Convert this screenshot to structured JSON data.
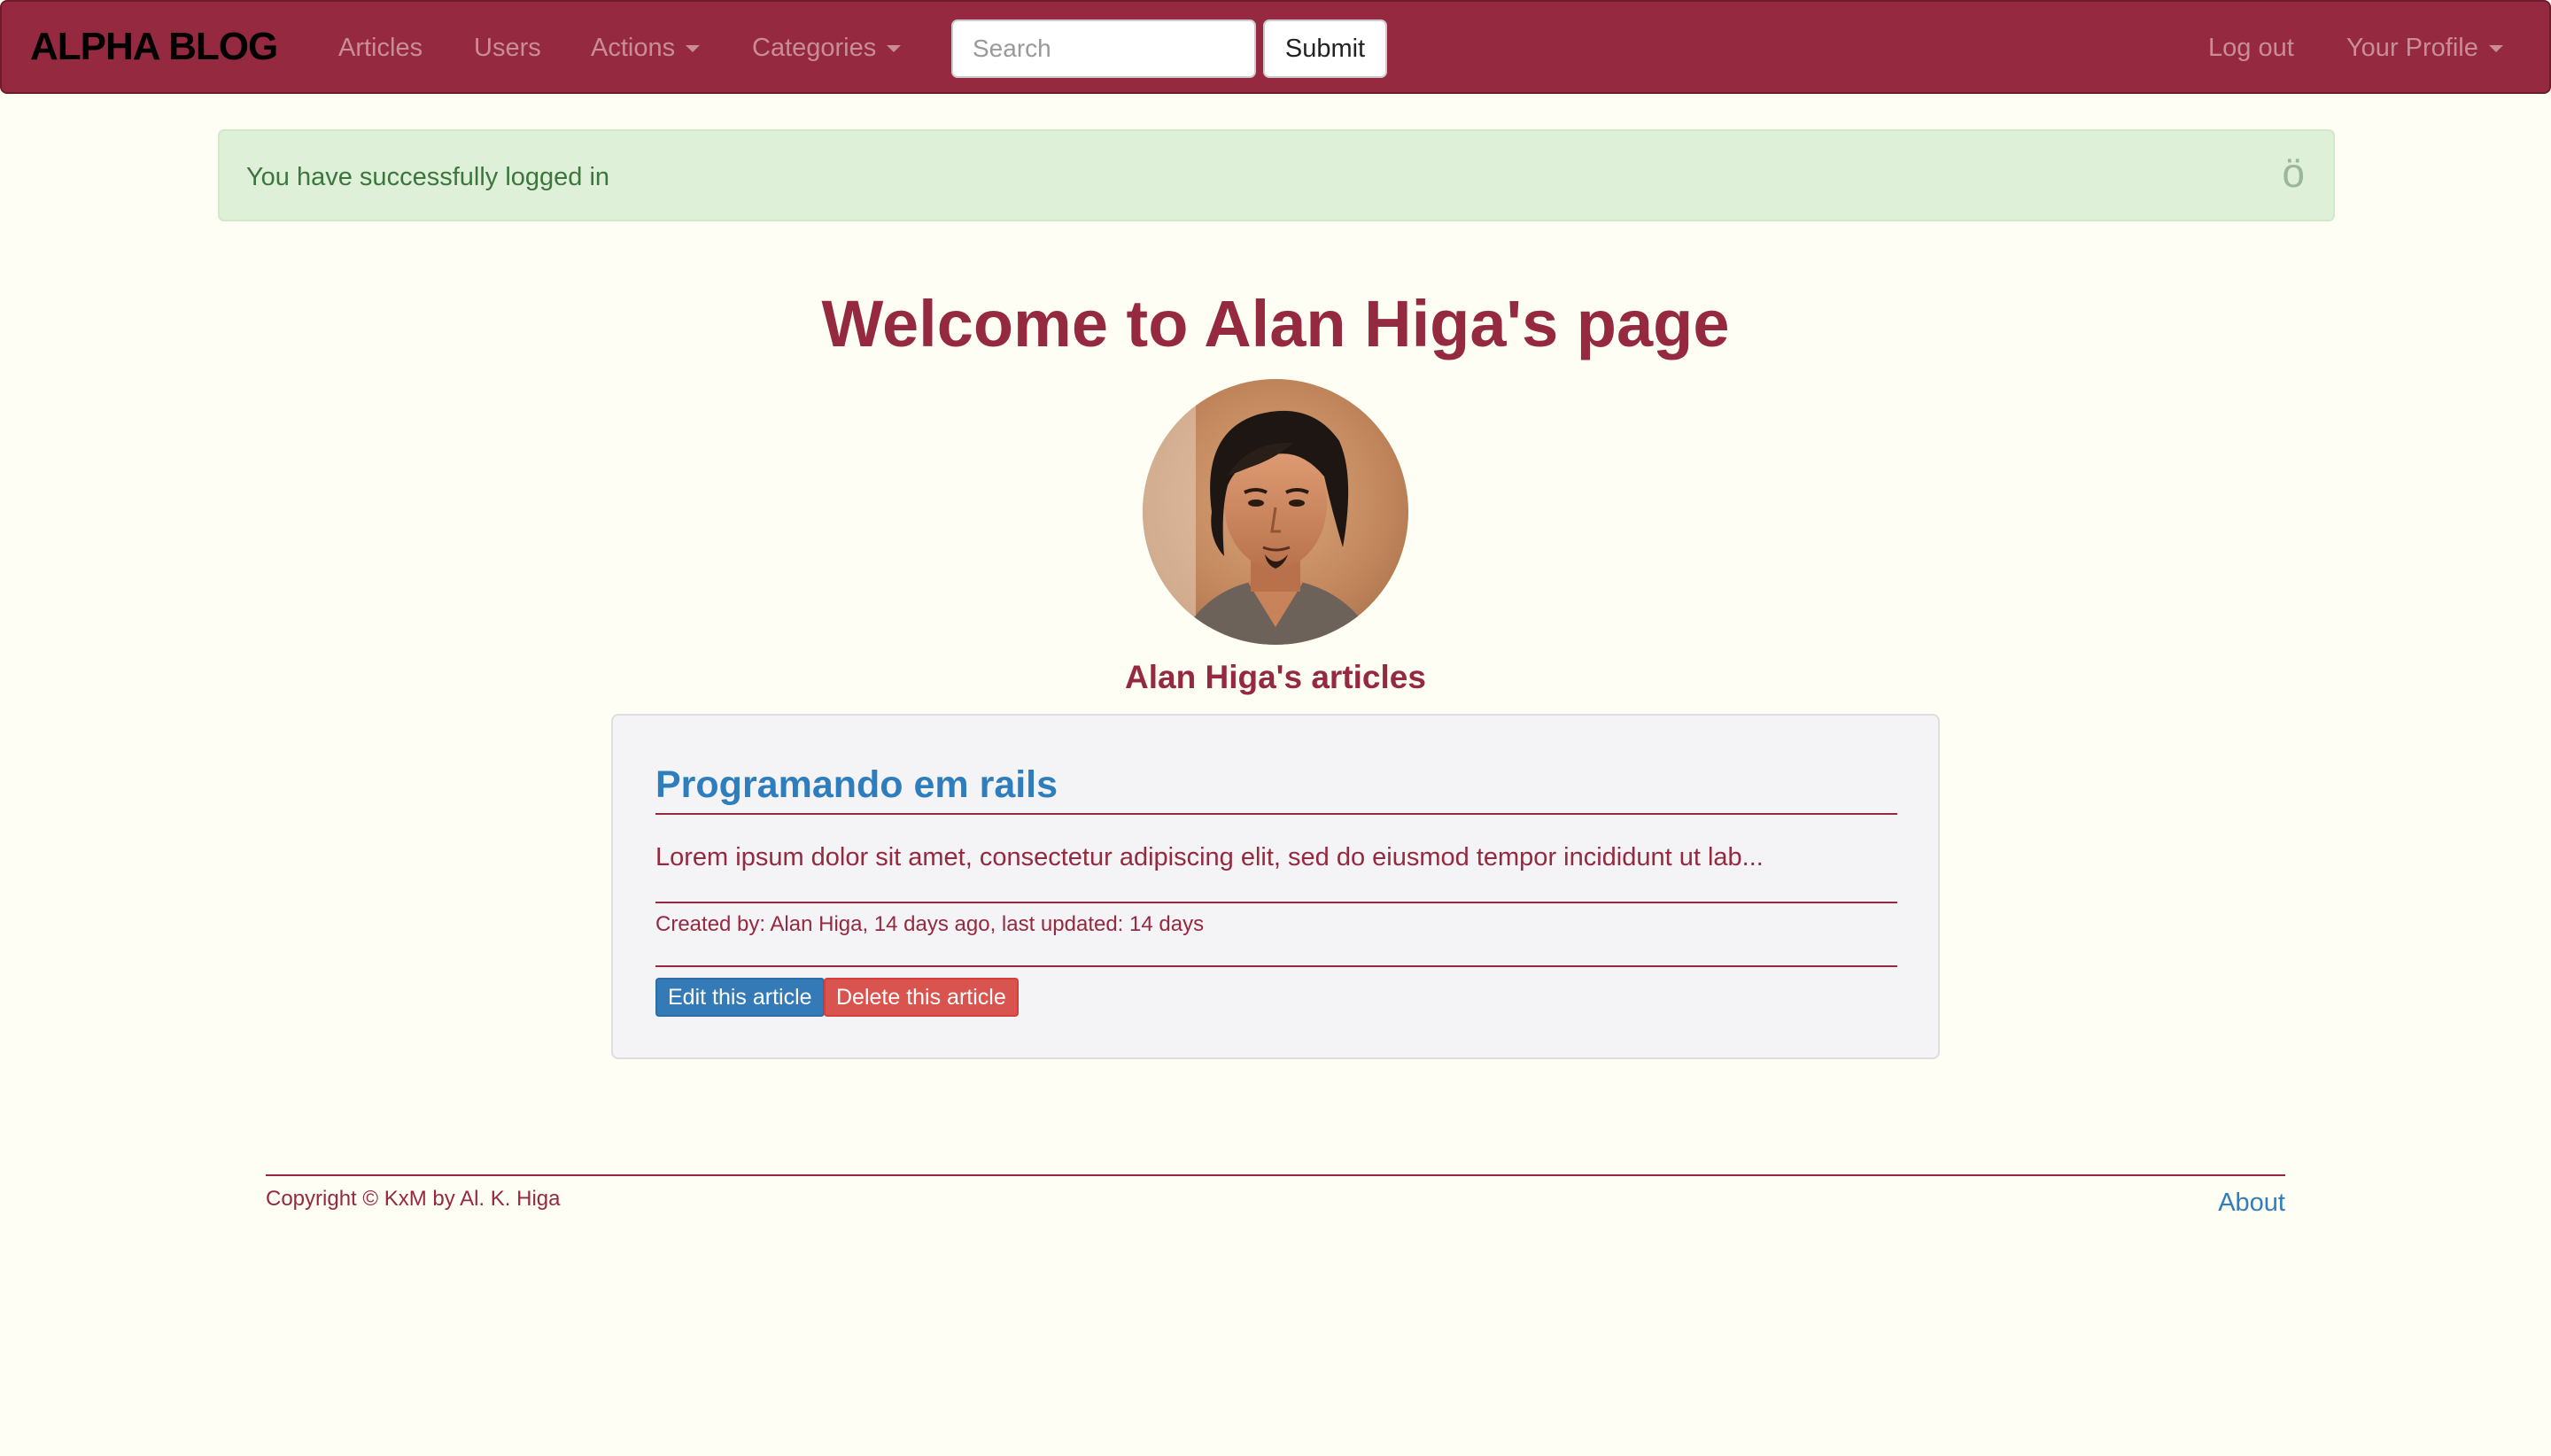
{
  "navbar": {
    "brand": "ALPHA BLOG",
    "links": {
      "articles": "Articles",
      "users": "Users",
      "actions": "Actions",
      "categories": "Categories",
      "logout": "Log out",
      "profile": "Your Profile"
    },
    "search": {
      "placeholder": "Search",
      "value": ""
    },
    "submit_label": "Submit"
  },
  "alert": {
    "message": "You have successfully logged in",
    "close_glyph": "ö"
  },
  "main": {
    "title": "Welcome to Alan Higa's page",
    "articles_heading": "Alan Higa's articles"
  },
  "articles": [
    {
      "title": "Programando em rails",
      "excerpt": "Lorem ipsum dolor sit amet, consectetur adipiscing elit, sed do eiusmod tempor incididunt ut lab...",
      "meta": "Created by: Alan Higa, 14 days ago, last updated: 14 days",
      "edit_label": "Edit this article",
      "delete_label": "Delete this article"
    }
  ],
  "footer": {
    "copyright": "Copyright © KxM by Al. K. Higa",
    "about": "About"
  },
  "colors": {
    "brand": "#95293f",
    "background": "#fefef5",
    "link": "#2e7dbd",
    "alert_bg": "#dff0d8",
    "alert_text": "#3c763d",
    "edit_button": "#337ab7",
    "delete_button": "#d9534f"
  }
}
